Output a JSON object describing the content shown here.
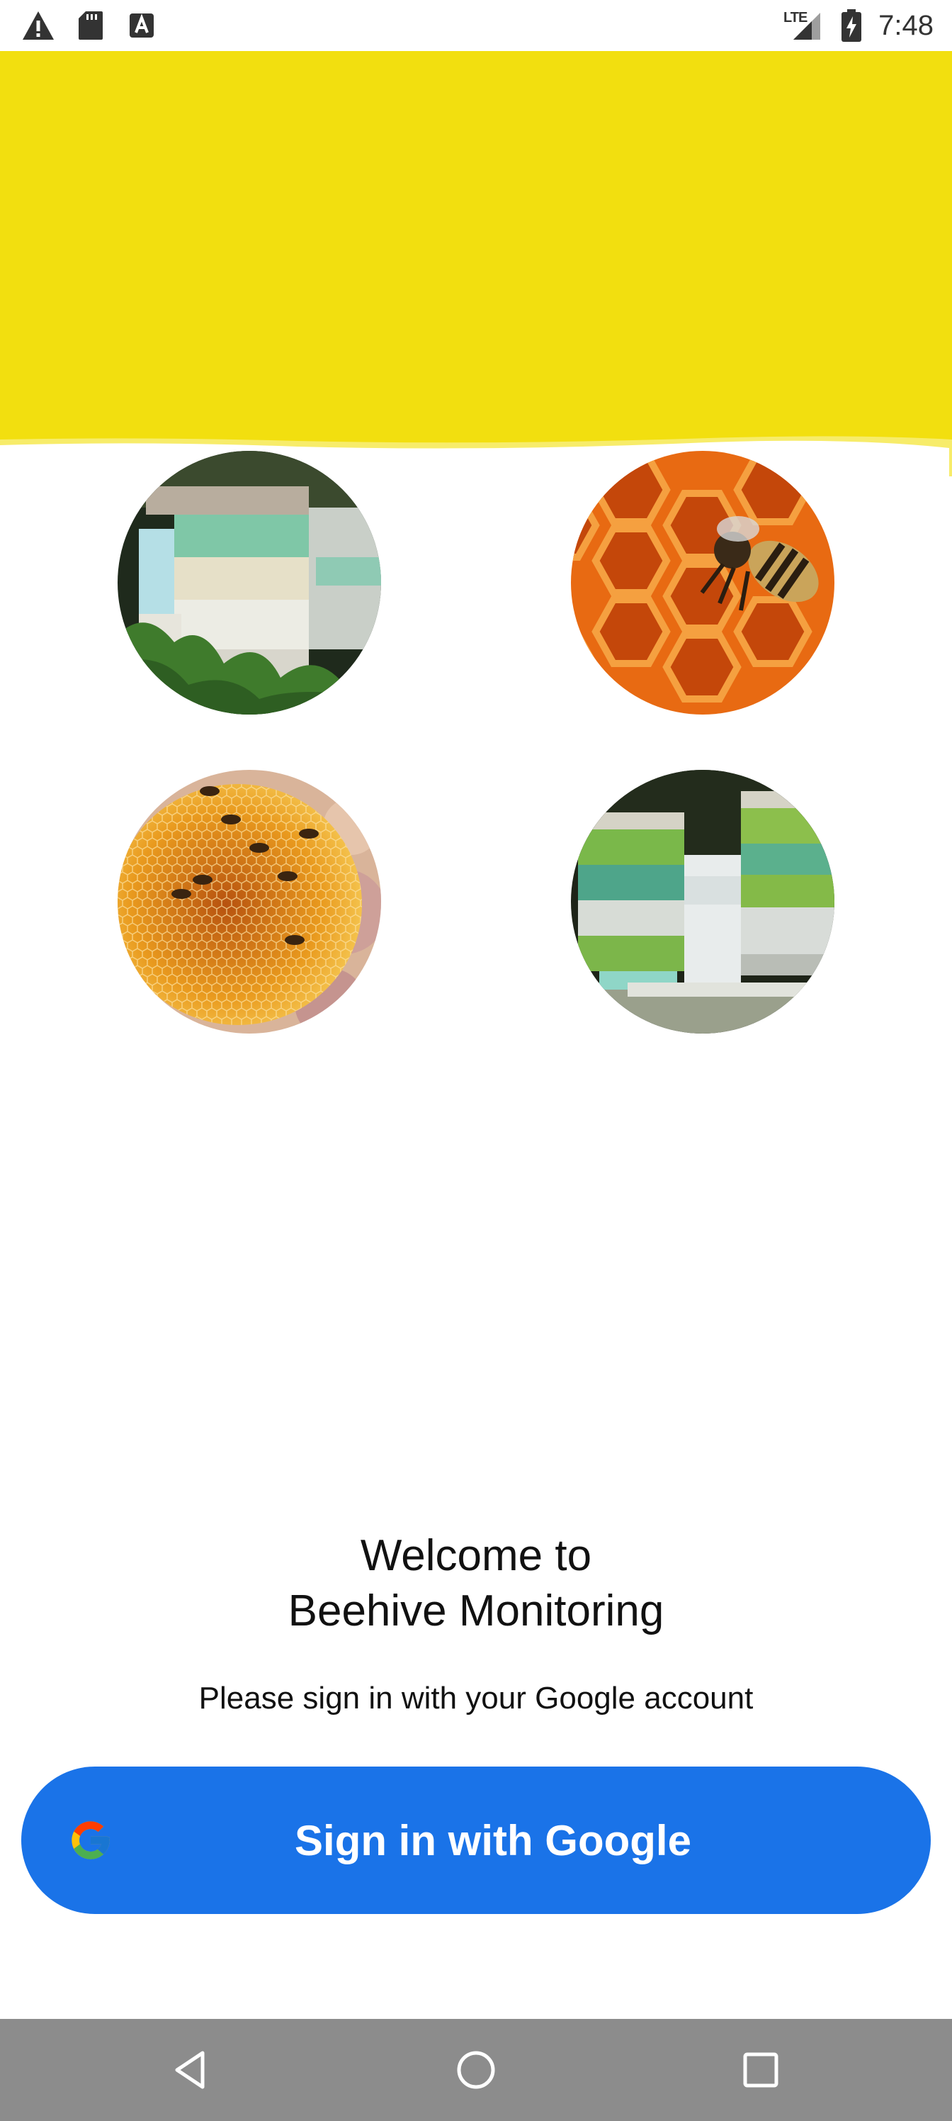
{
  "status_bar": {
    "time": "7:48",
    "network_label": "LTE",
    "left_icons": [
      "warning-icon",
      "sd-card-icon",
      "text-icon"
    ],
    "right_icons": [
      "signal-icon",
      "battery-charging-icon"
    ]
  },
  "theme": {
    "header_color": "#f2df0f",
    "button_color": "#1a73e8",
    "nav_bar_color": "#8c8c8c"
  },
  "photos": [
    {
      "name": "beehive-boxes-photo"
    },
    {
      "name": "bee-on-honeycomb-photo"
    },
    {
      "name": "honeycomb-with-bees-photo"
    },
    {
      "name": "colorful-hives-photo"
    }
  ],
  "welcome": {
    "line1": "Welcome to",
    "line2": "Beehive Monitoring",
    "subtitle": "Please sign in with your Google account"
  },
  "signin": {
    "label": "Sign in with Google",
    "icon": "google-g-icon"
  },
  "nav_bar": {
    "buttons": [
      "back-icon",
      "home-icon",
      "recents-icon"
    ]
  }
}
